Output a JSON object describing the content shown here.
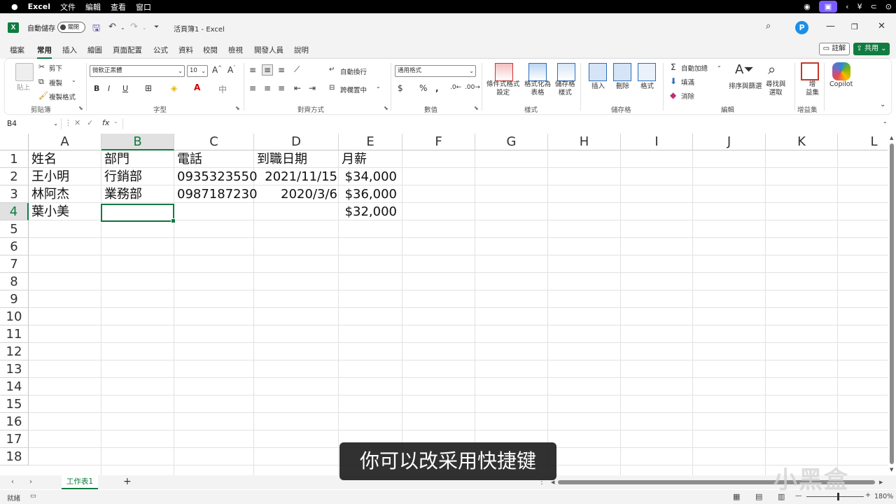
{
  "menubar": {
    "app_name": "Excel",
    "items": [
      "文件",
      "編輯",
      "查看",
      "窗口"
    ]
  },
  "titlebar": {
    "autosave_label": "自動儲存",
    "autosave_state": "關閉",
    "doc_title": "活頁簿1  -  Excel",
    "avatar_letter": "P"
  },
  "ribbon_tabs": [
    "檔案",
    "常用",
    "插入",
    "繪圖",
    "頁面配置",
    "公式",
    "資料",
    "校閱",
    "檢視",
    "開發人員",
    "說明"
  ],
  "active_tab": "常用",
  "comment_button": "註解",
  "share_button": "共用",
  "ribbon": {
    "clipboard": {
      "paste": "貼上",
      "cut": "剪下",
      "copy": "複製",
      "format_painter": "複製格式",
      "label": "剪貼簿"
    },
    "font": {
      "font_name": "微軟正黑體",
      "font_size": "10",
      "label": "字型"
    },
    "alignment": {
      "wrap": "自動換行",
      "merge": "跨欄置中",
      "label": "對齊方式"
    },
    "number": {
      "format": "通用格式",
      "label": "數值"
    },
    "styles": {
      "conditional": "條件式格式\n設定",
      "table": "格式化為\n表格",
      "cell_styles": "儲存格\n樣式",
      "label": "樣式"
    },
    "cells": {
      "insert": "插入",
      "delete": "刪除",
      "format": "格式",
      "label": "儲存格"
    },
    "editing": {
      "autosum": "自動加總",
      "fill": "填滿",
      "clear": "消除",
      "sort": "排序與篩選",
      "find": "尋找與\n選取",
      "label": "編輯"
    },
    "addins": {
      "addins": "增\n益集",
      "label": "增益集"
    },
    "copilot": "Copilot"
  },
  "formula_bar": {
    "name_box": "B4",
    "fx": "fx",
    "value": ""
  },
  "columns": [
    "A",
    "B",
    "C",
    "D",
    "E",
    "F",
    "G",
    "H",
    "I",
    "J",
    "K",
    "L"
  ],
  "selected_column": "B",
  "rows": [
    "1",
    "2",
    "3",
    "4",
    "5",
    "6",
    "7",
    "8",
    "9",
    "10",
    "11",
    "12",
    "13",
    "14",
    "15",
    "16",
    "17",
    "18"
  ],
  "selected_row": "4",
  "cells": {
    "A1": "姓名",
    "B1": "部門",
    "C1": "電話",
    "D1": "到職日期",
    "E1": "月薪",
    "A2": "王小明",
    "B2": "行銷部",
    "C2": "0935323550",
    "D2": "2021/11/15",
    "E2": "$34,000",
    "A3": "林阿杰",
    "B3": "業務部",
    "C3": "0987187230",
    "D3": "2020/3/6",
    "E3": "$36,000",
    "A4": "葉小美",
    "E4": "$32,000"
  },
  "sheet_tab": "工作表1",
  "status": {
    "ready": "就緒",
    "zoom": "180%"
  },
  "subtitle": "你可以改采用快捷键",
  "watermark": "小黑盒",
  "colors": {
    "accent": "#107c41",
    "header_sel_bg": "#e1e1e1"
  }
}
